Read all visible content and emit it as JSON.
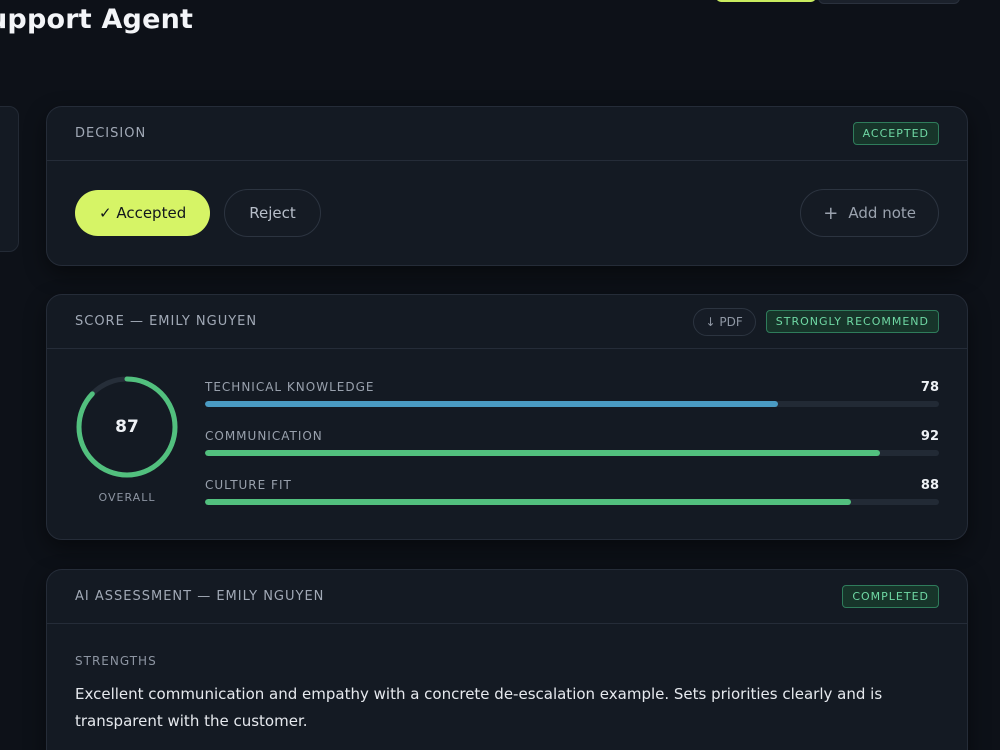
{
  "page": {
    "title": "upport Agent"
  },
  "colors": {
    "accent": "#d6f466",
    "bar_blue": "#4a9bc3",
    "bar_green": "#52c07e",
    "badge_green": "#6fd8a4"
  },
  "decision": {
    "title": "DECISION",
    "badge": "ACCEPTED",
    "accepted_label": "✓ Accepted",
    "reject_label": "Reject",
    "add_note_icon": "plus-icon",
    "add_note_label": "Add note"
  },
  "score": {
    "title": "SCORE — EMILY NGUYEN",
    "pdf_label": "↓ PDF",
    "badge": "STRONGLY RECOMMEND",
    "overall_value": "87",
    "overall_fraction": 0.87,
    "overall_label": "OVERALL",
    "metrics": [
      {
        "label": "TECHNICAL KNOWLEDGE",
        "value": "78",
        "percent": 78,
        "color": "#4a9bc3"
      },
      {
        "label": "COMMUNICATION",
        "value": "92",
        "percent": 92,
        "color": "#52c07e"
      },
      {
        "label": "CULTURE FIT",
        "value": "88",
        "percent": 88,
        "color": "#52c07e"
      }
    ]
  },
  "ai_assessment": {
    "title": "AI ASSESSMENT — EMILY NGUYEN",
    "badge": "COMPLETED",
    "strengths_label": "STRENGTHS",
    "strengths_text": "Excellent communication and empathy with a concrete de-escalation example. Sets priorities clearly and is transparent with the customer."
  }
}
